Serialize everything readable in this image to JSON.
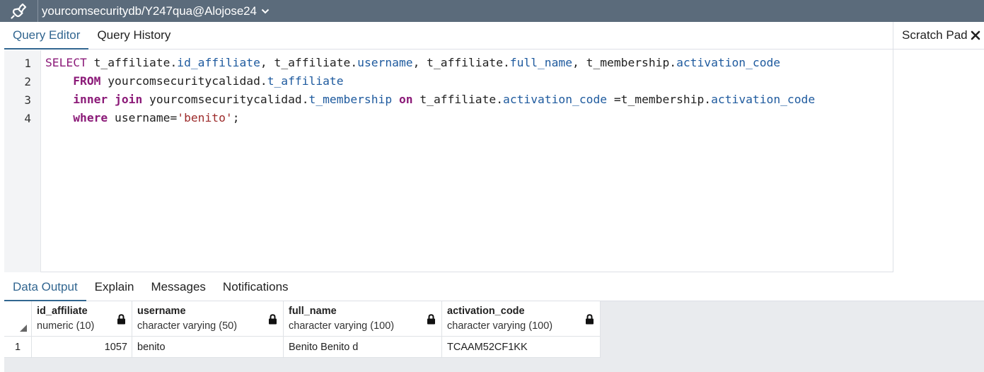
{
  "connection": {
    "title": "yourcomsecuritydb/Y247qua@Alojose24",
    "icon": "connection-plug-icon"
  },
  "editor_tabs": [
    {
      "label": "Query Editor",
      "active": true
    },
    {
      "label": "Query History",
      "active": false
    }
  ],
  "scratch_pad": {
    "title": "Scratch Pad",
    "close_icon": "close-icon"
  },
  "editor": {
    "line_numbers": [
      "1",
      "2",
      "3",
      "4"
    ],
    "lines": [
      [
        {
          "t": "SELECT",
          "c": "kw0"
        },
        {
          "t": " t_affiliate.",
          "c": ""
        },
        {
          "t": "id_affiliate",
          "c": "prop"
        },
        {
          "t": ", t_affiliate.",
          "c": ""
        },
        {
          "t": "username",
          "c": "prop"
        },
        {
          "t": ", t_affiliate.",
          "c": ""
        },
        {
          "t": "full_name",
          "c": "prop"
        },
        {
          "t": ", t_membership.",
          "c": ""
        },
        {
          "t": "activation_code",
          "c": "prop"
        }
      ],
      [
        {
          "t": "    ",
          "c": ""
        },
        {
          "t": "FROM",
          "c": "kw"
        },
        {
          "t": " yourcomsecuritycalidad.",
          "c": ""
        },
        {
          "t": "t_affiliate",
          "c": "prop"
        }
      ],
      [
        {
          "t": "    ",
          "c": ""
        },
        {
          "t": "inner join",
          "c": "kw"
        },
        {
          "t": " yourcomsecuritycalidad.",
          "c": ""
        },
        {
          "t": "t_membership",
          "c": "prop"
        },
        {
          "t": " ",
          "c": ""
        },
        {
          "t": "on",
          "c": "kw"
        },
        {
          "t": " t_affiliate.",
          "c": ""
        },
        {
          "t": "activation_code",
          "c": "prop"
        },
        {
          "t": " =t_membership.",
          "c": ""
        },
        {
          "t": "activation_code",
          "c": "prop"
        }
      ],
      [
        {
          "t": "    ",
          "c": ""
        },
        {
          "t": "where",
          "c": "kw"
        },
        {
          "t": " username=",
          "c": ""
        },
        {
          "t": "'benito'",
          "c": "str"
        },
        {
          "t": ";",
          "c": ""
        }
      ]
    ]
  },
  "output_tabs": [
    {
      "label": "Data Output",
      "active": true
    },
    {
      "label": "Explain",
      "active": false
    },
    {
      "label": "Messages",
      "active": false
    },
    {
      "label": "Notifications",
      "active": false
    }
  ],
  "grid": {
    "columns": [
      {
        "name": "id_affiliate",
        "type": "numeric (10)"
      },
      {
        "name": "username",
        "type": "character varying (50)"
      },
      {
        "name": "full_name",
        "type": "character varying (100)"
      },
      {
        "name": "activation_code",
        "type": "character varying (100)"
      }
    ],
    "rows": [
      {
        "row_number": "1",
        "cells": [
          "1057",
          "benito",
          "Benito Benito d",
          "TCAAM52CF1KK"
        ]
      }
    ]
  },
  "colors": {
    "topbar": "#5b6b7b",
    "accent": "#326690",
    "keyword": "#8b1a78",
    "identifier": "#1e5a9e",
    "string": "#9c2a2a"
  }
}
